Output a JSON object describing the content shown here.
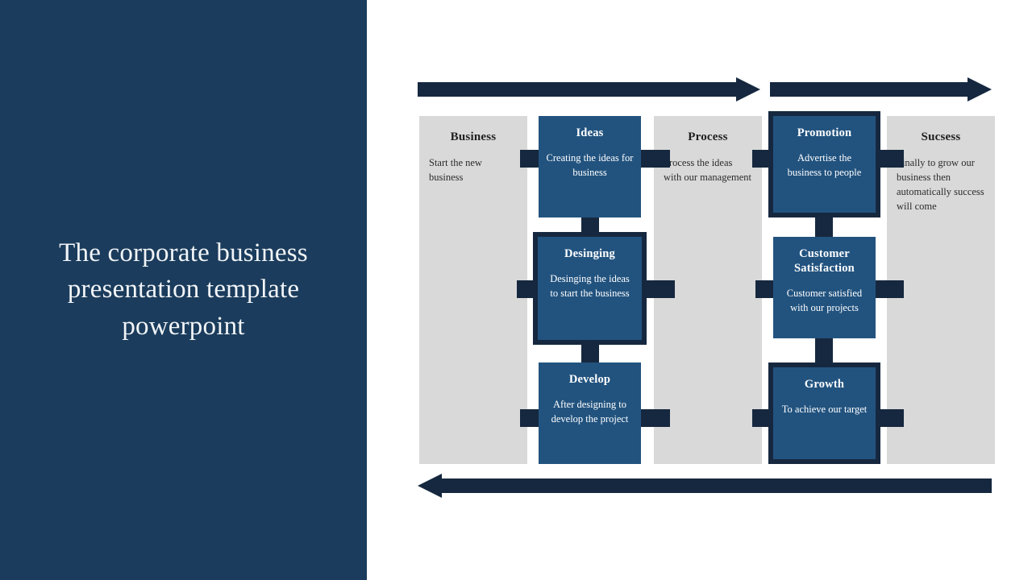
{
  "slide": {
    "title": "The corporate business presentation template powerpoint",
    "colors": {
      "panel_navy": "#1b3c5c",
      "card_blue": "#22537f",
      "connector_navy": "#16283f",
      "column_gray": "#d9d9d9",
      "background": "#ffffff"
    }
  },
  "arrows": [
    {
      "name": "top-left-arrow",
      "direction": "right"
    },
    {
      "name": "top-right-arrow",
      "direction": "right"
    },
    {
      "name": "bottom-arrow",
      "direction": "left"
    }
  ],
  "context_columns": [
    {
      "title": "Business",
      "body": "Start the new business"
    },
    {
      "title": "Process",
      "body": "Process the ideas with our management"
    },
    {
      "title": "Sucsess",
      "body": "Finally to grow our business then automatically success will come"
    }
  ],
  "steps": [
    {
      "title": "Ideas",
      "body": "Creating the ideas for business",
      "bordered": false
    },
    {
      "title": "Desinging",
      "body": "Desinging the ideas to start the business",
      "bordered": true
    },
    {
      "title": "Develop",
      "body": "After designing to develop the project",
      "bordered": false
    },
    {
      "title": "Promotion",
      "body": "Advertise the business to people",
      "bordered": true
    },
    {
      "title": "Customer Satisfaction",
      "body": "Customer satisfied with our projects",
      "bordered": false
    },
    {
      "title": "Growth",
      "body": "To achieve our target",
      "bordered": true
    }
  ]
}
